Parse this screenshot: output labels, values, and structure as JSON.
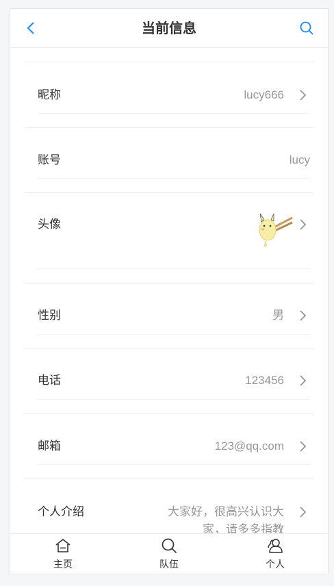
{
  "navbar": {
    "title": "当前信息"
  },
  "cells": {
    "nickname": {
      "label": "昵称",
      "value": "lucy666"
    },
    "account": {
      "label": "账号",
      "value": "lucy"
    },
    "avatar": {
      "label": "头像"
    },
    "gender": {
      "label": "性别",
      "value": "男"
    },
    "phone": {
      "label": "电话",
      "value": "123456"
    },
    "email": {
      "label": "邮箱",
      "value": "123@qq.com"
    },
    "intro": {
      "label": "个人介绍",
      "value": "大家好，很高兴认识大家，请多多指教"
    }
  },
  "tabbar": {
    "items": [
      {
        "label": "主页",
        "icon": "home-icon"
      },
      {
        "label": "队伍",
        "icon": "search-icon"
      },
      {
        "label": "个人",
        "icon": "user-icon"
      }
    ]
  },
  "colors": {
    "accent": "#1989fa",
    "text": "#323233",
    "muted": "#969799"
  }
}
